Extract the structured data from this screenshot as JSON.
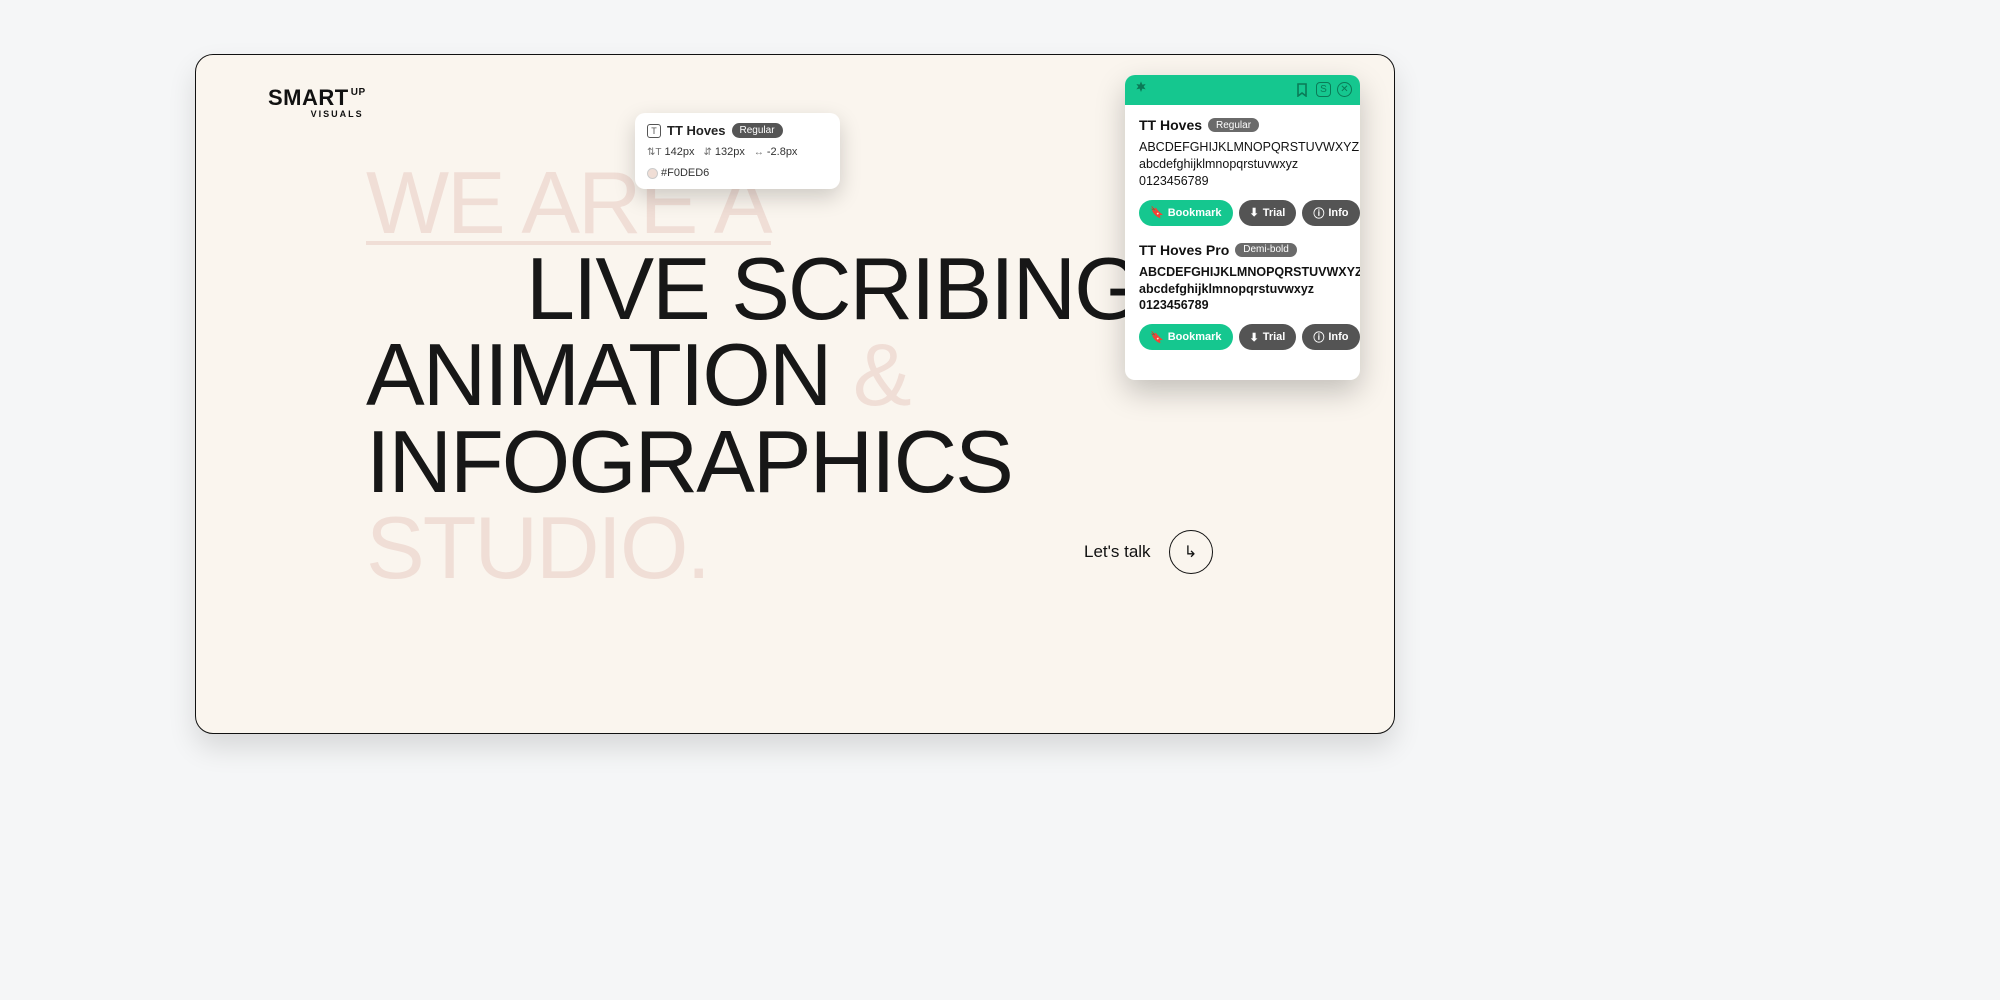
{
  "logo": {
    "main": "SMART",
    "sup": "UP",
    "sub": "VISUALS"
  },
  "hero": {
    "line1": "WE ARE A",
    "line2": "LIVE SCRIBING",
    "line3a": "ANIMATION ",
    "line3b": "&",
    "line4": "INFOGRAPHICS",
    "line5": "STUDIO."
  },
  "cta": {
    "label": "Let's talk",
    "arrow": "↳"
  },
  "tooltip": {
    "font_name": "TT Hoves",
    "weight": "Regular",
    "font_size": "142px",
    "line_height": "132px",
    "letter_spacing": "-2.8px",
    "color_hex": "#F0DED6"
  },
  "panel": {
    "fonts": [
      {
        "name": "TT Hoves",
        "weight_label": "Regular",
        "sample_upper": "ABCDEFGHIJKLMNOPQRSTUVWXYZ",
        "sample_lower": "abcdefghijklmnopqrstuvwxyz",
        "sample_digits": "0123456789",
        "demi": false
      },
      {
        "name": "TT Hoves Pro",
        "weight_label": "Demi-bold",
        "sample_upper": "ABCDEFGHIJKLMNOPQRSTUVWXYZ",
        "sample_lower": "abcdefghijklmnopqrstuvwxyz",
        "sample_digits": "0123456789",
        "demi": true
      }
    ],
    "buttons": {
      "bookmark": "Bookmark",
      "trial": "Trial",
      "info": "Info"
    }
  }
}
